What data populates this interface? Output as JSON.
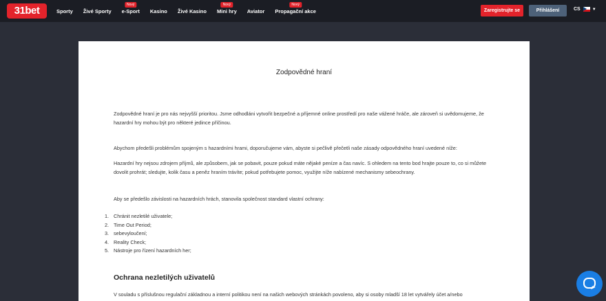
{
  "header": {
    "logo": "31bet",
    "nav": [
      {
        "label": "Sporty",
        "badge": ""
      },
      {
        "label": "Živé Sporty",
        "badge": ""
      },
      {
        "label": "e-Sport",
        "badge": "Nový"
      },
      {
        "label": "Kasino",
        "badge": ""
      },
      {
        "label": "Živé Kasino",
        "badge": ""
      },
      {
        "label": "Mini hry",
        "badge": "Nový"
      },
      {
        "label": "Aviator",
        "badge": ""
      },
      {
        "label": "Propagační akce",
        "badge": "Nový"
      }
    ],
    "register_label": "Zaregistrujte se",
    "login_label": "Přihlášení",
    "language": "CS",
    "colors": {
      "brand": "#e3232b",
      "login": "#4d6179",
      "chat": "#1a7ee4"
    }
  },
  "document": {
    "title": "Zodpovědné hraní",
    "paragraphs": [
      "Zodpovědné hraní je pro nás nejvyšší prioritou. Jsme odhodláni vytvořit bezpečné a příjemné online prostředí pro naše vážené hráče, ale zároveň si uvědomujeme, že hazardní hry mohou být pro některé jedince příčinou.",
      "Abychom předešli problémům spojeným s hazardními hrami, doporučujeme vám, abyste si pečlivě přečetli naše zásady odpovědného hraní uvedené níže:",
      "Hazardní hry nejsou zdrojem příjmů, ale způsobem, jak se pobavit, pouze pokud máte nějaké peníze a čas navíc. S ohledem na tento bod hrajte pouze to, co si můžete dovolit prohrát; sledujte, kolik času a peněz hraním trávíte; pokud potřebujete pomoc, využijte níže nabízené mechanismy sebeochrany.",
      "Aby se předešlo závislosti na hazardních hrách, stanovila společnost standard vlastní ochrany:"
    ],
    "list": [
      {
        "num": "1.",
        "text": "Chránit nezletilé uživatele;"
      },
      {
        "num": "2.",
        "text": "Time Out Period;"
      },
      {
        "num": "3.",
        "text": "sebevyloučení;"
      },
      {
        "num": "4.",
        "text": "Reality Check;"
      },
      {
        "num": "5.",
        "text": "Nástroje pro řízení hazardních her;"
      }
    ],
    "section_heading": "Ochrana nezletilých uživatelů",
    "section_text": "V souladu s příslušnou regulační základnou a interní politikou není na našich webových stránkách povoleno, aby si osoby mladší 18 let vytvářely účet a/nebo"
  },
  "chat": {
    "icon": "chat-bubble-icon"
  }
}
